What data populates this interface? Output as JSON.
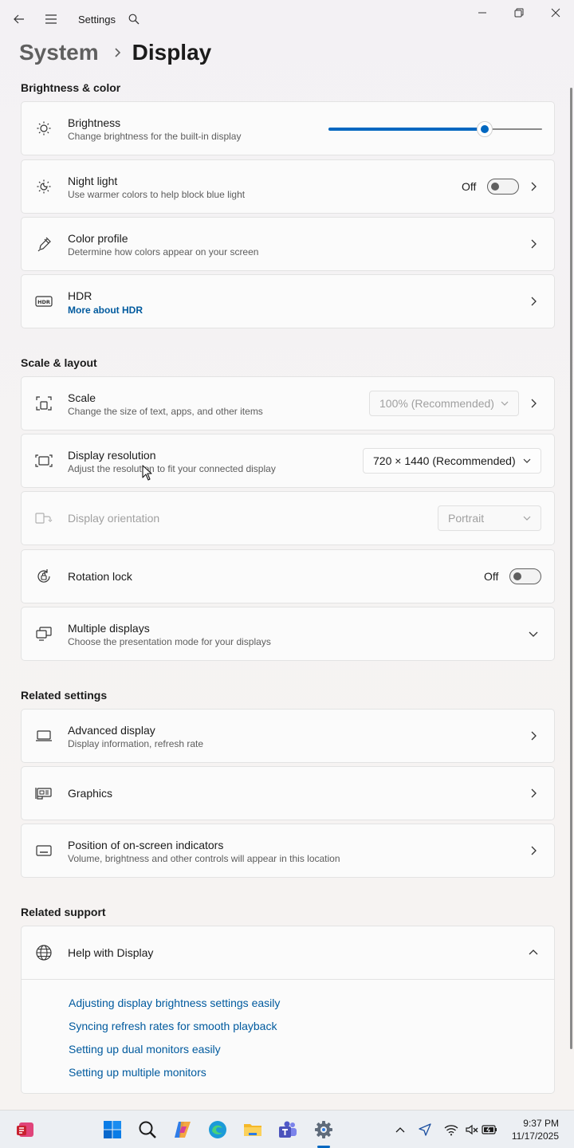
{
  "app": {
    "title": "Settings"
  },
  "breadcrumb": {
    "parent": "System",
    "current": "Display"
  },
  "sections": {
    "brightness_color": "Brightness & color",
    "scale_layout": "Scale & layout",
    "related_settings": "Related settings",
    "related_support": "Related support"
  },
  "brightness": {
    "title": "Brightness",
    "subtitle": "Change brightness for the built-in display",
    "level": 0.73
  },
  "night_light": {
    "title": "Night light",
    "subtitle": "Use warmer colors to help block blue light",
    "state": "Off"
  },
  "color_profile": {
    "title": "Color profile",
    "subtitle": "Determine how colors appear on your screen"
  },
  "hdr": {
    "title": "HDR",
    "link": "More about HDR"
  },
  "scale": {
    "title": "Scale",
    "subtitle": "Change the size of text, apps, and other items",
    "value": "100% (Recommended)"
  },
  "resolution": {
    "title": "Display resolution",
    "subtitle": "Adjust the resolution to fit your connected display",
    "value": "720 × 1440 (Recommended)"
  },
  "orientation": {
    "title": "Display orientation",
    "value": "Portrait"
  },
  "rotation_lock": {
    "title": "Rotation lock",
    "state": "Off"
  },
  "multiple_displays": {
    "title": "Multiple displays",
    "subtitle": "Choose the presentation mode for your displays"
  },
  "advanced_display": {
    "title": "Advanced display",
    "subtitle": "Display information, refresh rate"
  },
  "graphics": {
    "title": "Graphics"
  },
  "indicators": {
    "title": "Position of on-screen indicators",
    "subtitle": "Volume, brightness and other controls will appear in this location"
  },
  "help": {
    "title": "Help with Display",
    "links": [
      "Adjusting display brightness settings easily",
      "Syncing refresh rates for smooth playback",
      "Setting up dual monitors easily",
      "Setting up multiple monitors"
    ]
  },
  "taskbar": {
    "apps": [
      "office-icon",
      "start-icon",
      "search-icon",
      "copilot-icon",
      "edge-icon",
      "file-explorer-icon",
      "teams-icon",
      "settings-icon"
    ],
    "time": "9:37 PM",
    "date": "11/17/2025"
  },
  "colors": {
    "accent": "#0067c0",
    "link": "#005a9e"
  }
}
